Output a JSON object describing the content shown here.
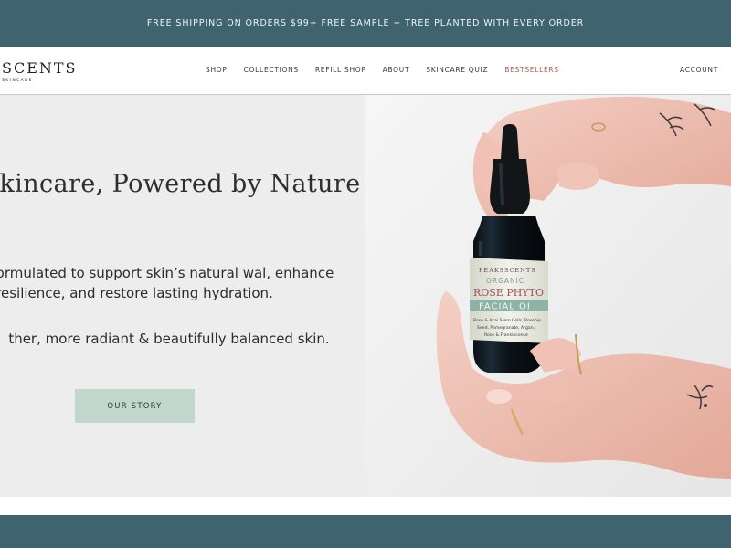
{
  "promo": {
    "text": "FREE SHIPPING ON ORDERS $99+ FREE SAMPLE + TREE PLANTED WITH EVERY ORDER"
  },
  "header": {
    "logo": {
      "word": "SCENTS",
      "tagline": "SKINCARE"
    },
    "nav": [
      {
        "label": "SHOP"
      },
      {
        "label": "COLLECTIONS"
      },
      {
        "label": "REFILL SHOP"
      },
      {
        "label": "ABOUT"
      },
      {
        "label": "SKINCARE QUIZ"
      },
      {
        "label": "BESTSELLERS",
        "highlight": true
      }
    ],
    "account_label": "ACCOUNT"
  },
  "hero": {
    "headline": "igent Skincare, Powered by Nature",
    "description": "ghtfully formulated to support skin’s natural wal, enhance resilience, and restore lasting hydration.",
    "description_2": "ther, more radiant & beautifully balanced skin.",
    "cta_label": "OUR STORY",
    "product": {
      "brand": "PEAKSSCENTS",
      "line1": "ORGANIC",
      "line2": "ROSE PHYTO",
      "line3": "FACIAL OI",
      "ingredients_1": "Rose & Acai Stem Cells, Rosehip",
      "ingredients_2": "Seed, Pomegranate, Argan,",
      "ingredients_3": "Rose & Frankincense"
    }
  },
  "colors": {
    "promo_bg": "#3f6470",
    "hero_left_bg": "#ededed",
    "cta_bg": "#c1d7cd",
    "bestsellers": "#b05a4c"
  }
}
